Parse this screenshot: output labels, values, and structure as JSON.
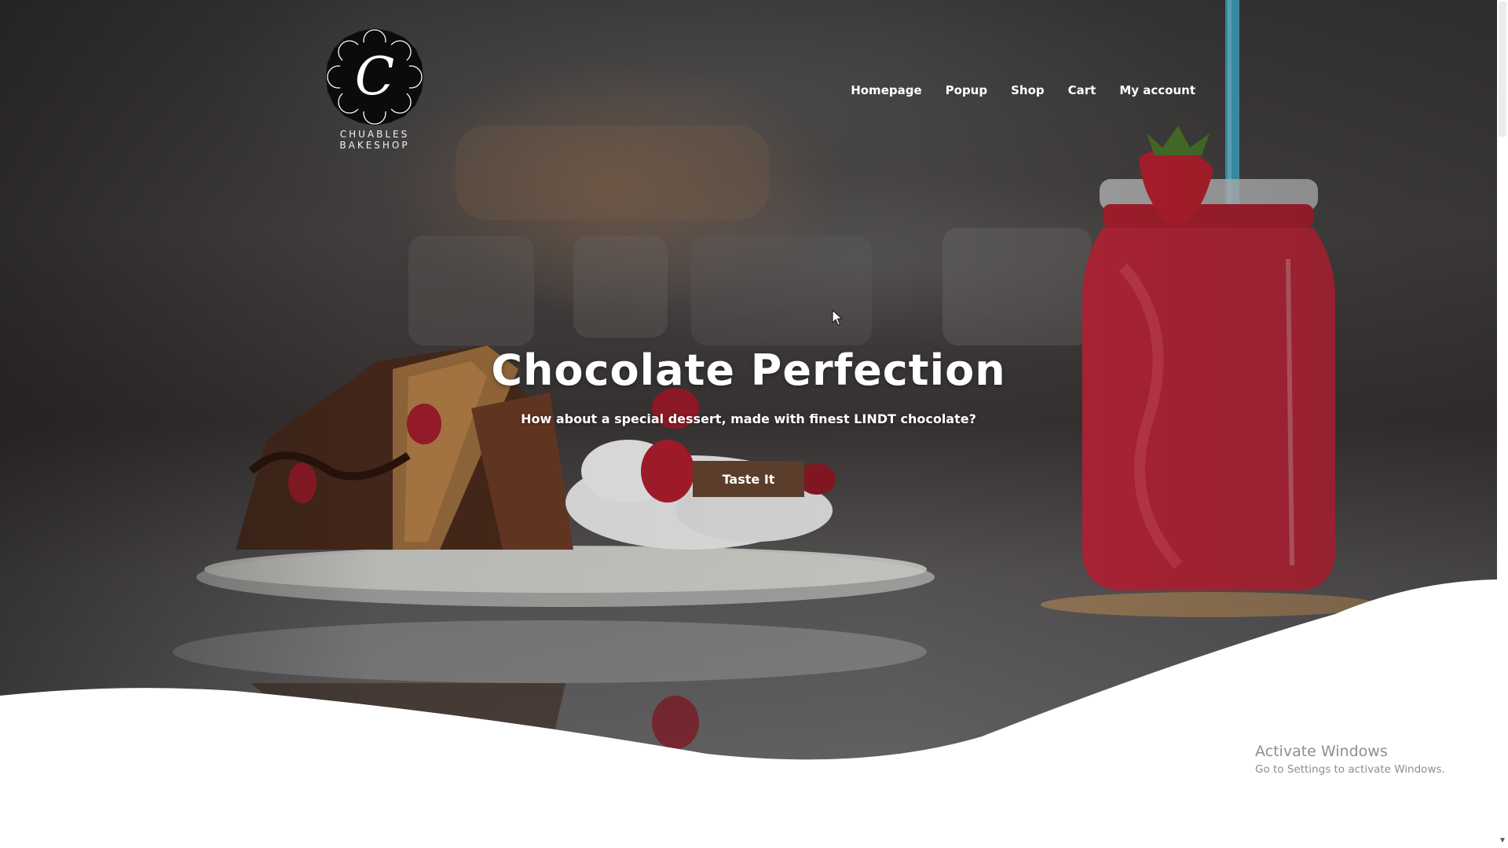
{
  "brand": {
    "logo_letter": "C",
    "logo_line1": "CHUABLES",
    "logo_line2": "BAKESHOP"
  },
  "nav": {
    "items": [
      "Homepage",
      "Popup",
      "Shop",
      "Cart",
      "My account"
    ]
  },
  "hero": {
    "title": "Chocolate Perfection",
    "subtitle": "How about a special dessert, made with finest LINDT chocolate?",
    "cta_label": "Taste It"
  },
  "watermark": {
    "title": "Activate Windows",
    "subtitle": "Go to Settings to activate Windows."
  },
  "colors": {
    "cta_background": "#5a3d2b",
    "nav_text": "#ffffff",
    "drink_red": "#c2263a"
  },
  "icons": {
    "cursor": "mouse-pointer-icon",
    "scroll_down": "chevron-down-icon"
  }
}
